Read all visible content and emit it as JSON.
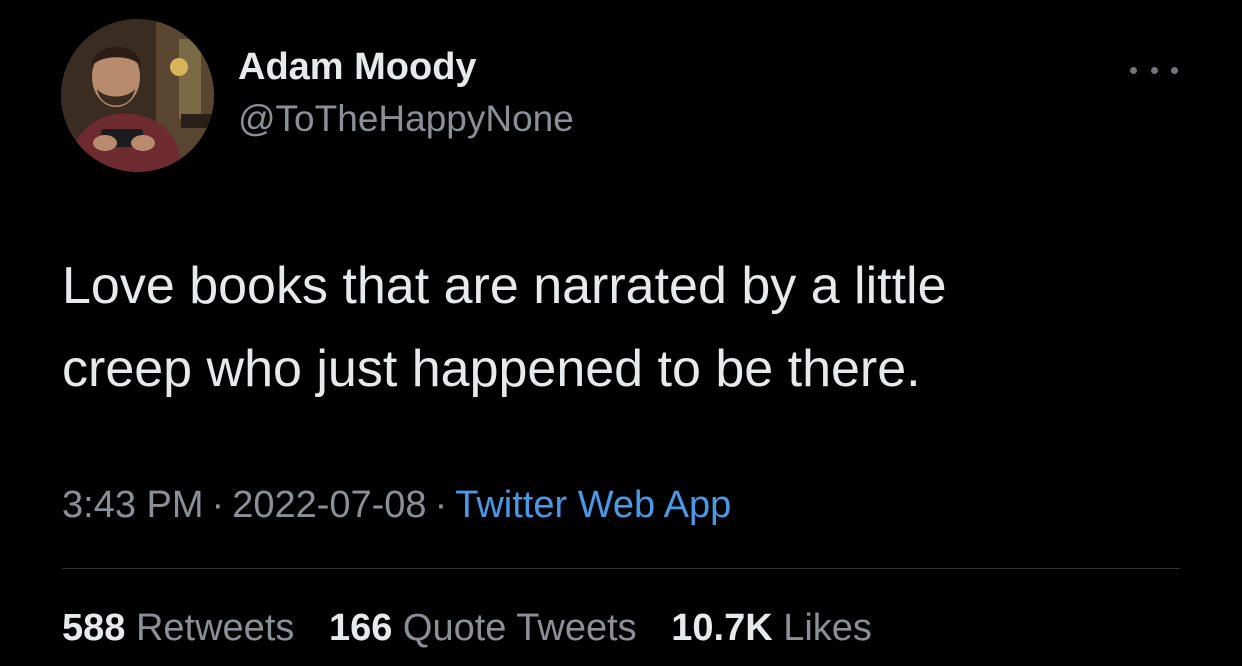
{
  "tweet": {
    "author": {
      "display_name": "Adam Moody",
      "handle": "@ToTheHappyNone"
    },
    "more_icon": "more-horizontal-icon",
    "text_lines": [
      "Love books that are narrated by a little",
      "creep who just happened to be there."
    ],
    "meta": {
      "time": "3:43 PM",
      "separator": "·",
      "date": "2022-07-08",
      "source": "Twitter Web App"
    },
    "stats": {
      "retweets": {
        "count": "588",
        "label": "Retweets"
      },
      "quotes": {
        "count": "166",
        "label": "Quote Tweets"
      },
      "likes": {
        "count": "10.7K",
        "label": "Likes"
      }
    }
  },
  "colors": {
    "background": "#000000",
    "primary_text": "#e7e9ea",
    "secondary_text": "#8b9096",
    "link": "#4a99e9",
    "divider": "#2f3336"
  }
}
